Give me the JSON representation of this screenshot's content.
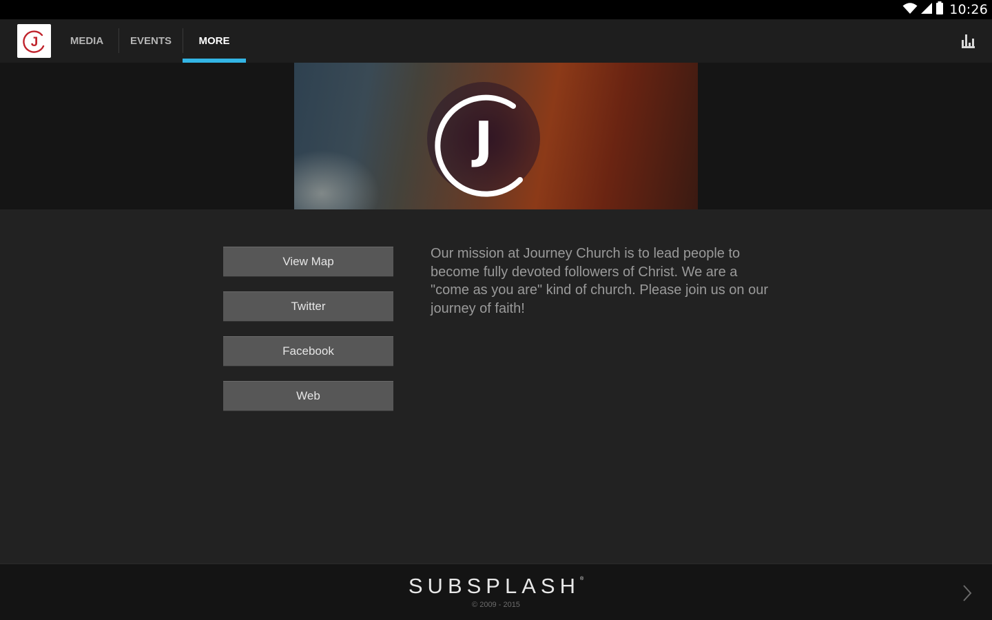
{
  "status_bar": {
    "time": "10:26",
    "icons": [
      "wifi-icon",
      "cell-signal-icon",
      "battery-icon"
    ]
  },
  "app": {
    "logo_letter": "J",
    "brand_color": "#c0232c",
    "accent_color": "#33b5e5"
  },
  "tabs": [
    {
      "label": "MEDIA",
      "active": false
    },
    {
      "label": "EVENTS",
      "active": false
    },
    {
      "label": "MORE",
      "active": true
    }
  ],
  "action_bar": {
    "right_icon": "bar-chart-icon"
  },
  "banner": {
    "logo_letter": "J"
  },
  "links": [
    {
      "label": "View Map"
    },
    {
      "label": "Twitter"
    },
    {
      "label": "Facebook"
    },
    {
      "label": "Web"
    }
  ],
  "mission": {
    "text": "Our mission at Journey Church is to lead people to become fully devoted followers of Christ. We are a \"come as you are\" kind of church. Please join us on our journey of faith!"
  },
  "footer": {
    "brand": "SUBSPLASH",
    "trademark": "®",
    "copyright": "© 2009 - 2015",
    "next_icon": "chevron-right-icon"
  }
}
